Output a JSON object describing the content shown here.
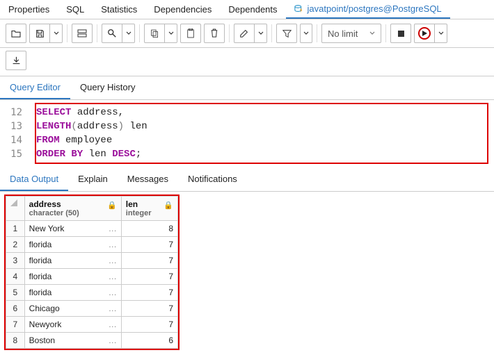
{
  "top_tabs": {
    "properties": "Properties",
    "sql": "SQL",
    "statistics": "Statistics",
    "dependencies": "Dependencies",
    "dependents": "Dependents",
    "connection": "javatpoint/postgres@PostgreSQL"
  },
  "toolbar": {
    "nolimit": "No limit"
  },
  "editor_tabs": {
    "query_editor": "Query Editor",
    "query_history": "Query History"
  },
  "editor": {
    "lines": [
      {
        "num": "12",
        "tokens": [
          [
            "kw",
            "SELECT"
          ],
          [
            "ident",
            " address,"
          ]
        ]
      },
      {
        "num": "13",
        "tokens": [
          [
            "fn",
            "LENGTH"
          ],
          [
            "paren",
            "("
          ],
          [
            "ident",
            "address"
          ],
          [
            "paren",
            ")"
          ],
          [
            "ident",
            " len"
          ]
        ]
      },
      {
        "num": "14",
        "tokens": [
          [
            "kw",
            "FROM"
          ],
          [
            "ident",
            " employee"
          ]
        ]
      },
      {
        "num": "15",
        "tokens": [
          [
            "kw",
            "ORDER BY"
          ],
          [
            "ident",
            " len "
          ],
          [
            "kw",
            "DESC"
          ],
          [
            "ident",
            ";"
          ]
        ]
      }
    ]
  },
  "result_tabs": {
    "data_output": "Data Output",
    "explain": "Explain",
    "messages": "Messages",
    "notifications": "Notifications"
  },
  "grid": {
    "columns": [
      {
        "name": "address",
        "type": "character (50)"
      },
      {
        "name": "len",
        "type": "integer"
      }
    ],
    "rows": [
      {
        "n": "1",
        "address": "New York",
        "len": "8"
      },
      {
        "n": "2",
        "address": "florida",
        "len": "7"
      },
      {
        "n": "3",
        "address": "florida",
        "len": "7"
      },
      {
        "n": "4",
        "address": "florida",
        "len": "7"
      },
      {
        "n": "5",
        "address": "florida",
        "len": "7"
      },
      {
        "n": "6",
        "address": "Chicago",
        "len": "7"
      },
      {
        "n": "7",
        "address": "Newyork",
        "len": "7"
      },
      {
        "n": "8",
        "address": "Boston",
        "len": "6"
      }
    ]
  }
}
